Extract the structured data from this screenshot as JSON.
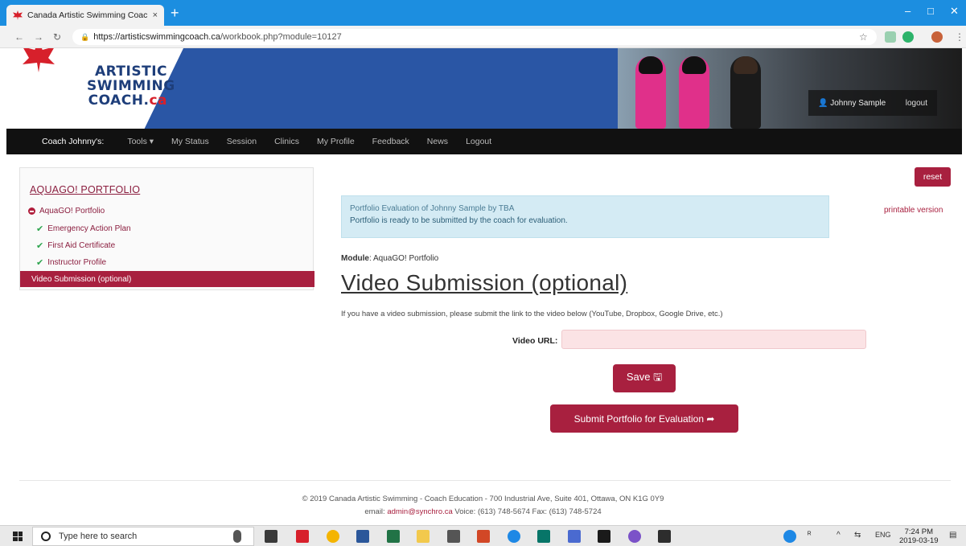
{
  "browser": {
    "tab_title": "Canada Artistic Swimming Coach",
    "tab_close": "×",
    "new_tab": "+",
    "url_host": "https://artisticswimmingcoach.ca",
    "url_path": "/workbook.php?module=10127",
    "win_minimize": "–",
    "win_maximize": "□",
    "win_close": "✕"
  },
  "banner": {
    "logo_line1": "ARTISTIC",
    "logo_line2": "SWIMMING",
    "logo_line3": "COACH.",
    "logo_ca": "ca",
    "user_name": "Johnny Sample",
    "logout": "logout"
  },
  "nav": {
    "brand": "Coach Johnny's:",
    "items": [
      "Tools ▾",
      "My Status",
      "Session",
      "Clinics",
      "My Profile",
      "Feedback",
      "News",
      "Logout"
    ]
  },
  "sidebar": {
    "heading": "AQUAGO! PORTFOLIO",
    "section": "AquaGO! Portfolio",
    "items": [
      "Emergency Action Plan",
      "First Aid Certificate",
      "Instructor Profile"
    ],
    "active": "Video Submission (optional)"
  },
  "main": {
    "reset": "reset",
    "printable": "printable version",
    "info_line1": "Portfolio Evaluation of Johnny Sample by TBA",
    "info_line2": "Portfolio is ready to be submitted by the coach for evaluation.",
    "module_label": "Module",
    "module_value": ": AquaGO! Portfolio",
    "title": "Video Submission (optional)",
    "description": "If you have a video submission, please submit the link to the video below (YouTube, Dropbox, Google Drive, etc.)",
    "url_label": "Video URL:",
    "url_value": "",
    "save": "Save 🖫",
    "submit": "Submit Portfolio for Evaluation ➦"
  },
  "footer": {
    "line1": "© 2019 Canada Artistic Swimming - Coach Education - 700 Industrial Ave, Suite 401, Ottawa, ON K1G 0Y9",
    "email_label": "email: ",
    "email": "admin@synchro.ca",
    "contact": " Voice: (613) 748-5674 Fax: (613) 748-5724"
  },
  "taskbar": {
    "search_placeholder": "Type here to search",
    "lang": "ENG",
    "time": "7:24 PM",
    "date": "2019-03-19"
  },
  "colors": {
    "brand": "#a8203f",
    "chrome_blue": "#1c8ee0",
    "banner_blue": "#2a56a5"
  }
}
